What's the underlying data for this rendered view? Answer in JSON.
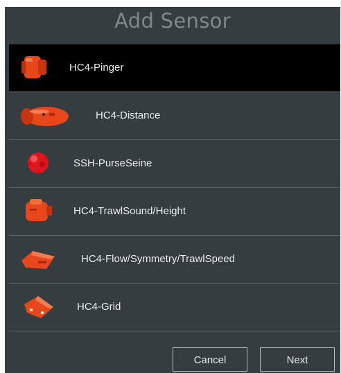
{
  "dialog": {
    "title": "Add Sensor",
    "sensors": [
      {
        "label": "HC4-Pinger",
        "icon": "pinger-sensor-icon",
        "selected": true
      },
      {
        "label": "HC4-Distance",
        "icon": "distance-sensor-icon",
        "selected": false
      },
      {
        "label": "SSH-PurseSeine",
        "icon": "purseseine-sensor-icon",
        "selected": false
      },
      {
        "label": "HC4-TrawlSound/Height",
        "icon": "trawlsound-sensor-icon",
        "selected": false
      },
      {
        "label": "HC4-Flow/Symmetry/TrawlSpeed",
        "icon": "flow-sensor-icon",
        "selected": false
      },
      {
        "label": "HC4-Grid",
        "icon": "grid-sensor-icon",
        "selected": false
      }
    ],
    "buttons": {
      "cancel": "Cancel",
      "next": "Next"
    }
  },
  "colors": {
    "background": "#353d41",
    "selected_row": "#000000",
    "sensor_orange": "#e8461b",
    "purse_seine_red": "#e0161e"
  }
}
